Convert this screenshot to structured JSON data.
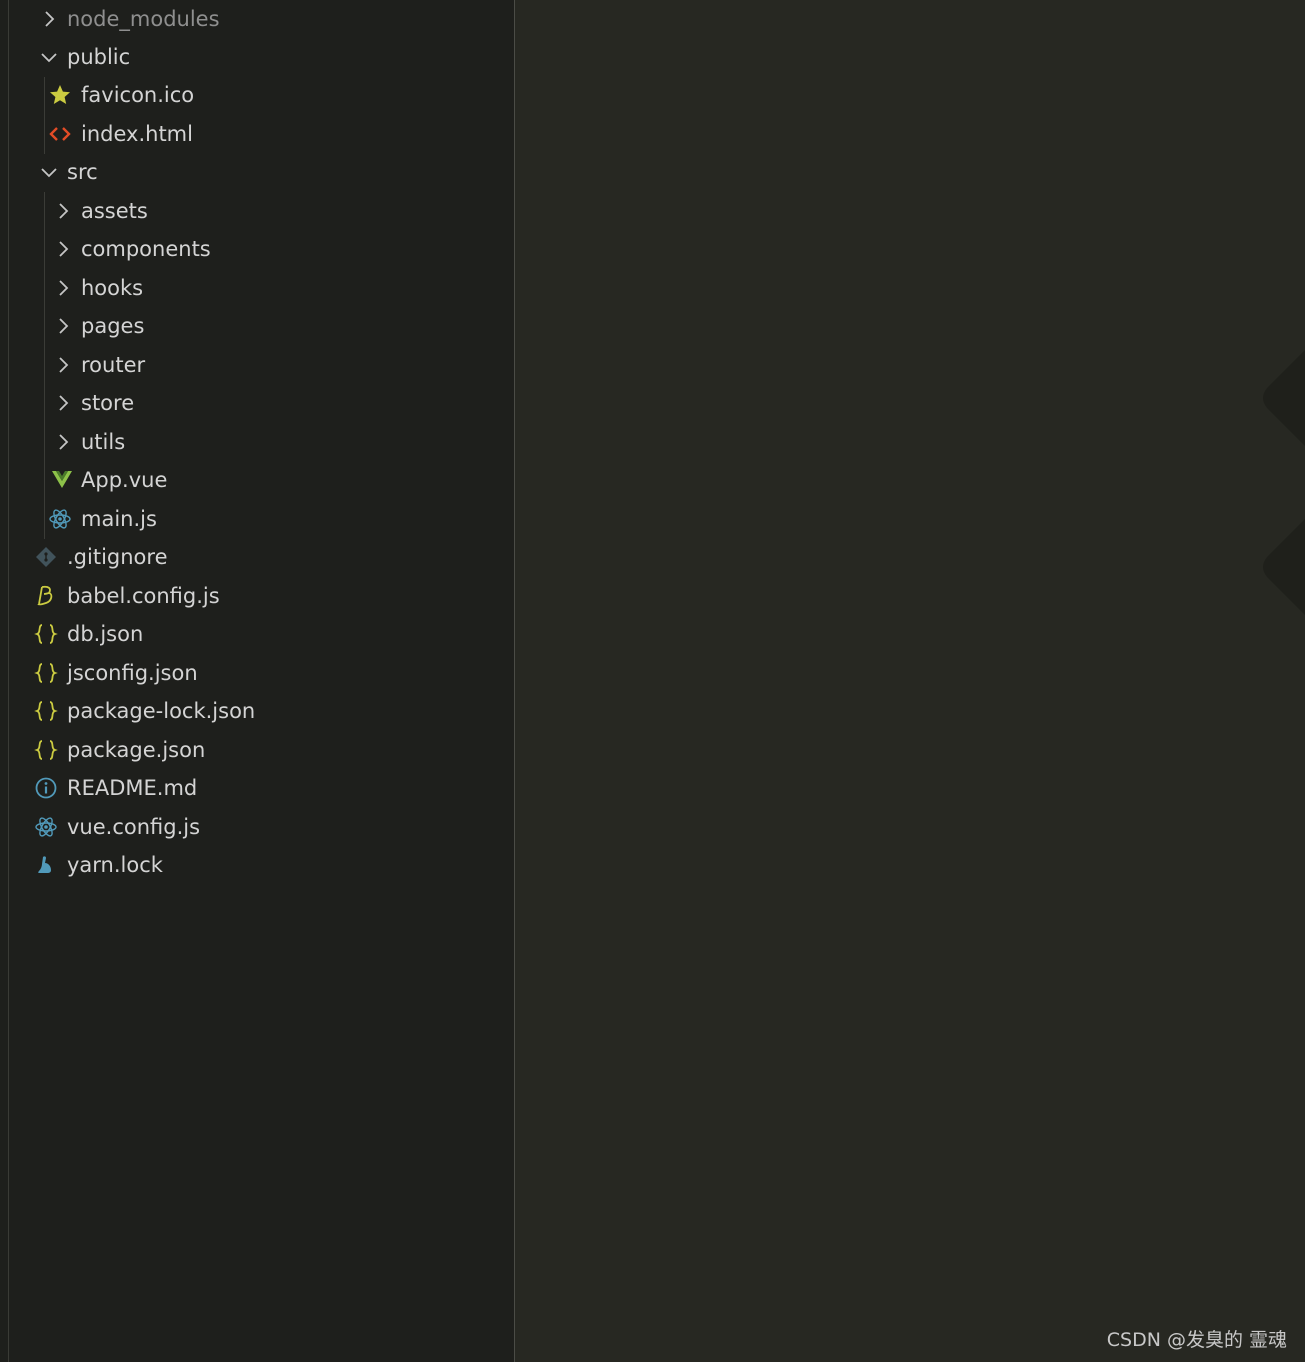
{
  "explorer": {
    "items": [
      {
        "label": "node_modules",
        "icon": "chevron-right-icon"
      },
      {
        "label": "public",
        "icon": "chevron-down-icon"
      },
      {
        "label": "favicon.ico",
        "icon": "star-icon"
      },
      {
        "label": "index.html",
        "icon": "html-tag-icon"
      },
      {
        "label": "src",
        "icon": "chevron-down-icon"
      },
      {
        "label": "assets",
        "icon": "chevron-right-icon"
      },
      {
        "label": "components",
        "icon": "chevron-right-icon"
      },
      {
        "label": "hooks",
        "icon": "chevron-right-icon"
      },
      {
        "label": "pages",
        "icon": "chevron-right-icon"
      },
      {
        "label": "router",
        "icon": "chevron-right-icon"
      },
      {
        "label": "store",
        "icon": "chevron-right-icon"
      },
      {
        "label": "utils",
        "icon": "chevron-right-icon"
      },
      {
        "label": "App.vue",
        "icon": "vue-icon"
      },
      {
        "label": "main.js",
        "icon": "react-atom-icon"
      },
      {
        "label": ".gitignore",
        "icon": "git-icon"
      },
      {
        "label": "babel.config.js",
        "icon": "babel-icon"
      },
      {
        "label": "db.json",
        "icon": "json-braces-icon"
      },
      {
        "label": "jsconfig.json",
        "icon": "json-braces-icon"
      },
      {
        "label": "package-lock.json",
        "icon": "json-braces-icon"
      },
      {
        "label": "package.json",
        "icon": "json-braces-icon"
      },
      {
        "label": "README.md",
        "icon": "info-icon"
      },
      {
        "label": "vue.config.js",
        "icon": "react-atom-icon"
      },
      {
        "label": "yarn.lock",
        "icon": "yarn-icon"
      }
    ]
  },
  "colors": {
    "sidebar_bg": "#1e1f1c",
    "editor_bg": "#272822",
    "text": "#d4d4d4",
    "json": "#cbcb41",
    "html": "#e34c26",
    "vue": "#8dc149",
    "react": "#519aba"
  },
  "watermark": "CSDN @发臭的 霊魂"
}
